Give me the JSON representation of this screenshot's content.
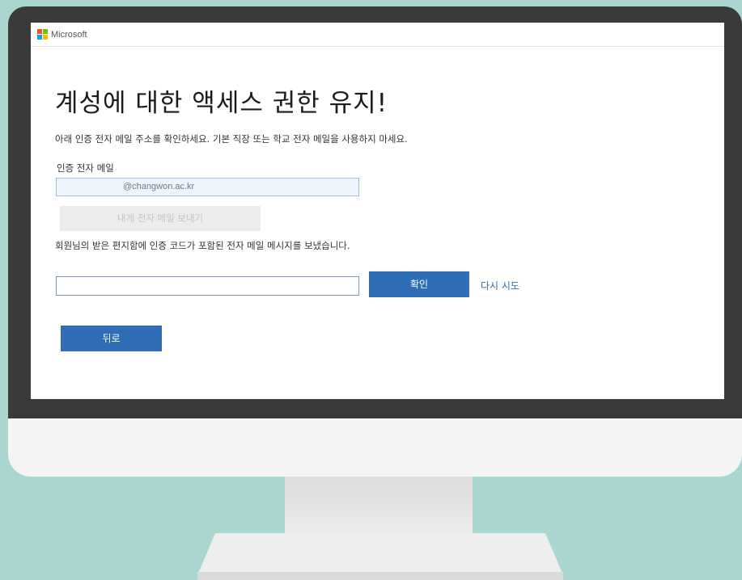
{
  "brand": {
    "name": "Microsoft",
    "logo_colors": [
      "#f25022",
      "#7fba00",
      "#00a4ef",
      "#ffb900"
    ]
  },
  "page": {
    "title": "계성에 대한 액세스 권한 유지!",
    "description": "아래 인증 전자 메일 주소를 확인하세요. 기본 직장 또는 학교 전자 메일을 사용하지 마세요.",
    "email_label": "인증 전자 메일",
    "email_value": "@changwon.ac.kr",
    "send_button_label": "내게 전자 메일 보내기",
    "sent_note": "회원님의 받은 편지함에 인증 코드가 포함된 전자 메일 메시지를 보냈습니다.",
    "code_placeholder": "",
    "confirm_button_label": "확인",
    "retry_link_label": "다시 시도",
    "back_button_label": "뒤로"
  },
  "colors": {
    "accent": "#2f6eb7",
    "disabled_bg": "#ececec",
    "background": "#a9d6d1",
    "monitor_frame": "#3a3a3a"
  },
  "icons": [
    "microsoft-logo-icon"
  ]
}
